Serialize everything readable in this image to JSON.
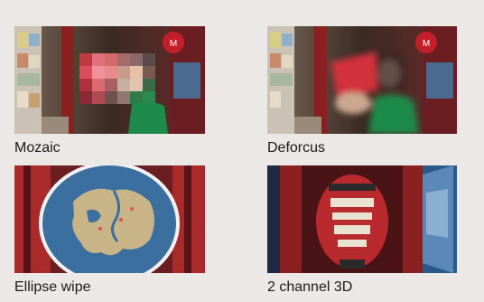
{
  "effects": [
    {
      "label": "Mozaic",
      "thumbnail_icon": "mosaic-effect-thumbnail"
    },
    {
      "label": "Deforcus",
      "thumbnail_icon": "defocus-effect-thumbnail"
    },
    {
      "label": "Ellipse wipe",
      "thumbnail_icon": "ellipse-wipe-thumbnail"
    },
    {
      "label": "2 channel 3D",
      "thumbnail_icon": "two-channel-3d-thumbnail"
    }
  ],
  "colors": {
    "background": "#ebe8e6",
    "shop_red": "#b3282d",
    "globe_blue": "#3a6fa0",
    "dark_frame": "#1e2a44"
  }
}
